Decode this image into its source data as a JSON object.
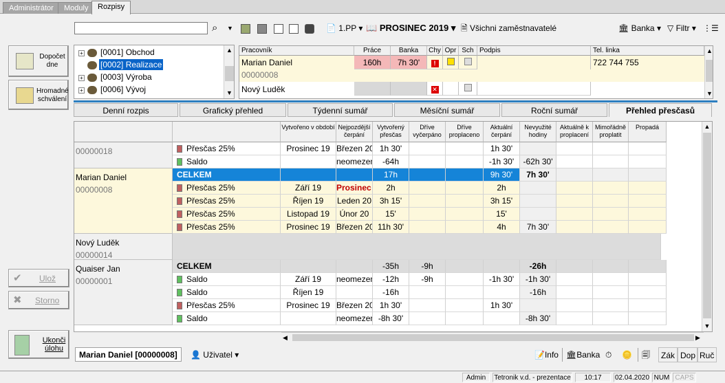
{
  "tabs": [
    "Administrátor",
    "Moduly",
    "Rozpisy"
  ],
  "toolbar": {
    "search_value": "",
    "pp": "1.PP",
    "period": "PROSINEC 2019",
    "employers": "Všichni zaměstnavatelé",
    "banka": "Banka",
    "filtr": "Filtr"
  },
  "left": {
    "dopocet": "Dopočet dne",
    "hromadne": "Hromadné schválení",
    "uloz": "Ulož",
    "storno": "Storno",
    "ukonci": "Ukonči úlohu"
  },
  "tree": [
    "[0001] Obchod",
    "[0002] Realizace",
    "[0003] Výroba",
    "[0006] Vývoj"
  ],
  "emp_table": {
    "headers": [
      "Pracovník",
      "Práce",
      "Banka",
      "Chy",
      "Opr",
      "Sch",
      "Podpis",
      "Tel. linka"
    ],
    "rows": [
      {
        "name": "Marian Daniel",
        "id": "00000008",
        "prace": "160h",
        "banka": "7h 30'",
        "tel": "722 744 755"
      },
      {
        "name": "Nový Luděk",
        "id": "00000014",
        "prace": "",
        "banka": "",
        "tel": ""
      }
    ]
  },
  "view_tabs": [
    "Denní rozpis",
    "Grafický přehled",
    "Týdenní sumář",
    "Měsíční sumář",
    "Roční sumář",
    "Přehled přesčasů"
  ],
  "grid": {
    "headers": [
      "Vytvořeno v období",
      "Nejpozdější čerpání",
      "Vytvořený přesčas",
      "Dříve vyčerpáno",
      "Dříve proplaceno",
      "Aktuální čerpání",
      "Nevyužité hodiny",
      "Aktuálně k proplacení",
      "Mimořádně proplatit",
      "Propadá"
    ],
    "groups": [
      {
        "name": "",
        "id": "00000018",
        "rows": [
          {
            "type": "Přesčas 25%",
            "color": "#c06060",
            "c": [
              "Prosinec 19",
              "Březen 20",
              "1h 30'",
              "",
              "",
              "1h 30'",
              "",
              "",
              "",
              ""
            ]
          },
          {
            "type": "Saldo",
            "color": "#60c060",
            "c": [
              "",
              "neomezeno",
              "-64h",
              "",
              "",
              "-1h 30'",
              "-62h 30'",
              "",
              "",
              ""
            ]
          }
        ]
      },
      {
        "name": "Marian Daniel",
        "id": "00000008",
        "total": {
          "label": "CELKEM",
          "c": [
            "",
            "",
            "17h",
            "",
            "",
            "9h 30'",
            "7h 30'",
            "",
            "",
            ""
          ]
        },
        "rows": [
          {
            "type": "Přesčas 25%",
            "color": "#c06060",
            "c": [
              "Září 19",
              "Prosinec 19",
              "2h",
              "",
              "",
              "2h",
              "",
              "",
              "",
              ""
            ]
          },
          {
            "type": "Přesčas 25%",
            "color": "#c06060",
            "c": [
              "Říjen 19",
              "Leden 20",
              "3h 15'",
              "",
              "",
              "3h 15'",
              "",
              "",
              "",
              ""
            ]
          },
          {
            "type": "Přesčas 25%",
            "color": "#c06060",
            "c": [
              "Listopad 19",
              "Únor 20",
              "15'",
              "",
              "",
              "15'",
              "",
              "",
              "",
              ""
            ]
          },
          {
            "type": "Přesčas 25%",
            "color": "#c06060",
            "c": [
              "Prosinec 19",
              "Březen 20",
              "11h 30'",
              "",
              "",
              "4h",
              "7h 30'",
              "",
              "",
              ""
            ]
          }
        ]
      },
      {
        "name": "Nový Luděk",
        "id": "00000014",
        "rows": []
      },
      {
        "name": "Quaiser Jan",
        "id": "00000001",
        "total": {
          "label": "CELKEM",
          "c": [
            "",
            "",
            "-35h",
            "-9h",
            "",
            "",
            "-26h",
            "",
            "",
            ""
          ]
        },
        "rows": [
          {
            "type": "Saldo",
            "color": "#60c060",
            "c": [
              "Září 19",
              "neomezeno",
              "-12h",
              "-9h",
              "",
              "-1h 30'",
              "-1h 30'",
              "",
              "",
              ""
            ]
          },
          {
            "type": "Saldo",
            "color": "#60c060",
            "c": [
              "Říjen 19",
              "",
              "-16h",
              "",
              "",
              "",
              "-16h",
              "",
              "",
              ""
            ]
          },
          {
            "type": "Přesčas 25%",
            "color": "#c06060",
            "c": [
              "Prosinec 19",
              "Březen 20",
              "1h 30'",
              "",
              "",
              "1h 30'",
              "",
              "",
              "",
              ""
            ]
          },
          {
            "type": "Saldo",
            "color": "#60c060",
            "c": [
              "",
              "neomezeno",
              "-8h 30'",
              "",
              "",
              "",
              "-8h 30'",
              "",
              "",
              ""
            ]
          }
        ]
      }
    ]
  },
  "bottom": {
    "current": "Marian Daniel [00000008]",
    "uzivatel": "Uživatel",
    "info": "Info",
    "banka": "Banka",
    "zak": "Zák",
    "dop": "Dop",
    "ruc": "Ruč"
  },
  "status": {
    "user": "Admin",
    "company": "Tetronik v.d. - prezentace",
    "time": "10:17",
    "date": "02.04.2020",
    "num": "NUM",
    "caps": "CAPS"
  },
  "colors": {
    "accent": "#0a64c8",
    "selected_row": "#fdf8dc",
    "total_row_blue": "#1584d8"
  }
}
